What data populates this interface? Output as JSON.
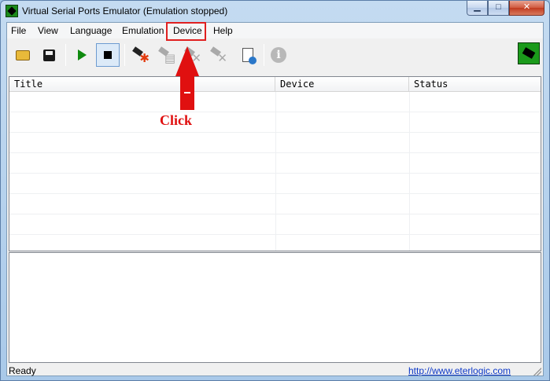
{
  "window": {
    "title": "Virtual Serial Ports Emulator (Emulation stopped)",
    "minimize_glyph": "▁",
    "maximize_glyph": "□",
    "close_glyph": "✕"
  },
  "menu": {
    "items": [
      {
        "label": "File"
      },
      {
        "label": "View"
      },
      {
        "label": "Language"
      },
      {
        "label": "Emulation"
      },
      {
        "label": "Device"
      },
      {
        "label": "Help"
      }
    ]
  },
  "toolbar": {
    "buttons": [
      {
        "icon": "open-folder-icon",
        "enabled": true
      },
      {
        "icon": "save-icon",
        "enabled": true
      },
      {
        "icon": "play-icon",
        "enabled": true
      },
      {
        "icon": "stop-icon",
        "enabled": true,
        "pressed": true
      },
      {
        "icon": "create-device-icon",
        "enabled": true,
        "mark": "✱"
      },
      {
        "icon": "edit-device-icon",
        "enabled": false,
        "mark": "▤"
      },
      {
        "icon": "delete-device-icon",
        "enabled": false,
        "mark": "✕"
      },
      {
        "icon": "delete-all-devices-icon",
        "enabled": false,
        "mark": "✕"
      },
      {
        "icon": "properties-globe-icon",
        "enabled": true
      },
      {
        "icon": "info-icon",
        "enabled": false,
        "glyph": "i"
      }
    ]
  },
  "device_list": {
    "columns": [
      "Title",
      "Device",
      "Status"
    ],
    "rows": []
  },
  "statusbar": {
    "status": "Ready",
    "link": "http://www.eterlogic.com"
  },
  "annotation": {
    "label": "Click",
    "color": "#e01010"
  },
  "colors": {
    "accent_green": "#1b9a1b",
    "annotation_red": "#e01010",
    "link_blue": "#0a37c8"
  }
}
